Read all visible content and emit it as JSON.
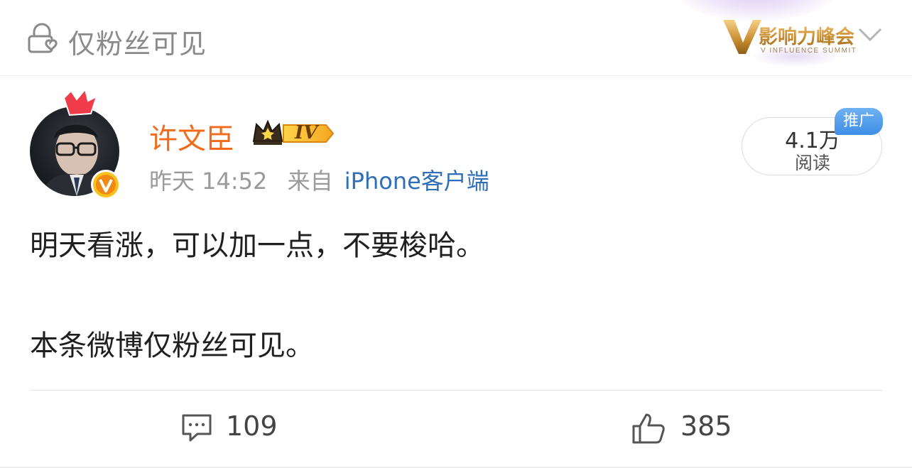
{
  "header": {
    "visibility_label": "仅粉丝可见",
    "brand": {
      "title": "影响力峰会",
      "subtitle": "V INFLUENCE SUMMIT",
      "mark": "V"
    }
  },
  "post": {
    "author": "许文臣",
    "member_level": "IV",
    "verified_mark": "V",
    "time": "昨天 14:52",
    "source_prefix": "来自",
    "source": "iPhone客户端",
    "read_count": "4.1万",
    "read_label": "阅读",
    "promo_tag": "推广",
    "body_lines": [
      "明天看涨，可以加一点，不要梭哈。",
      "本条微博仅粉丝可见。"
    ]
  },
  "actions": {
    "comments": "109",
    "likes": "385"
  },
  "colors": {
    "author": "#f26b1d",
    "link": "#2f6fb8",
    "muted": "#9a9a9a",
    "promo": "#3f8ee6",
    "badge_gold": "#f7c21a"
  }
}
